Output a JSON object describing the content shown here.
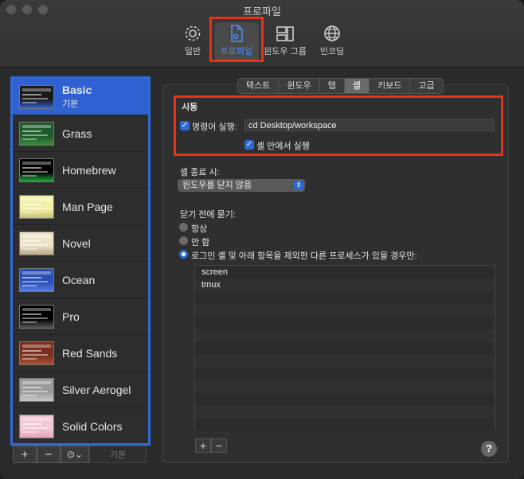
{
  "window": {
    "title": "프로파일"
  },
  "toolbar": {
    "items": [
      {
        "label": "일반",
        "icon": "gear-icon"
      },
      {
        "label": "프로파일",
        "icon": "profile-document-icon"
      },
      {
        "label": "윈도우 그룹",
        "icon": "window-groups-icon"
      },
      {
        "label": "인코딩",
        "icon": "globe-icon"
      }
    ]
  },
  "profiles": [
    {
      "name": "Basic",
      "subtitle": "기본",
      "colors": [
        "#1a1a1a",
        "#2f61d3"
      ]
    },
    {
      "name": "Grass",
      "colors": [
        "#1f5a2a",
        "#3b8a3f"
      ]
    },
    {
      "name": "Homebrew",
      "colors": [
        "#000000",
        "#1fa83a"
      ]
    },
    {
      "name": "Man Page",
      "colors": [
        "#f3f0a8",
        "#c8c070"
      ]
    },
    {
      "name": "Novel",
      "colors": [
        "#ece3c8",
        "#b7a98a"
      ]
    },
    {
      "name": "Ocean",
      "colors": [
        "#2a4fb5",
        "#5a7de0"
      ]
    },
    {
      "name": "Pro",
      "colors": [
        "#000000",
        "#555555"
      ]
    },
    {
      "name": "Red Sands",
      "colors": [
        "#7a2f1e",
        "#a8512e"
      ]
    },
    {
      "name": "Silver Aerogel",
      "colors": [
        "#9a9a9a",
        "#c9c9c9"
      ]
    },
    {
      "name": "Solid Colors",
      "colors": [
        "#f2c8d6",
        "#e8a0b8"
      ]
    }
  ],
  "sidebar_controls": {
    "add": "+",
    "remove": "−",
    "more": "⊙⌄",
    "default": "기본"
  },
  "tabs": [
    {
      "label": "텍스트"
    },
    {
      "label": "윈도우"
    },
    {
      "label": "탭"
    },
    {
      "label": "셸",
      "active": true
    },
    {
      "label": "키보드"
    },
    {
      "label": "고급"
    }
  ],
  "startup": {
    "heading": "시동",
    "run_command_label": "명령어 실행:",
    "run_command_value": "cd Desktop/workspace",
    "run_in_shell_label": "셸 안에서 실행"
  },
  "on_exit": {
    "heading": "셸 종료 시:",
    "selected": "윈도우를 닫지 않음"
  },
  "ask_before_close": {
    "heading": "닫기 전에 묻기:",
    "options": [
      "항상",
      "안 함",
      "로그인 셸 및 아래 항목을 제외한 다른 프로세스가 있을 경우만:"
    ],
    "selected_index": 2
  },
  "processes": [
    "screen",
    "tmux"
  ],
  "list_controls": {
    "add": "+",
    "remove": "−"
  },
  "help": "?",
  "colors": {
    "accent": "#2f6bd8",
    "annotation": "#e8331c"
  }
}
